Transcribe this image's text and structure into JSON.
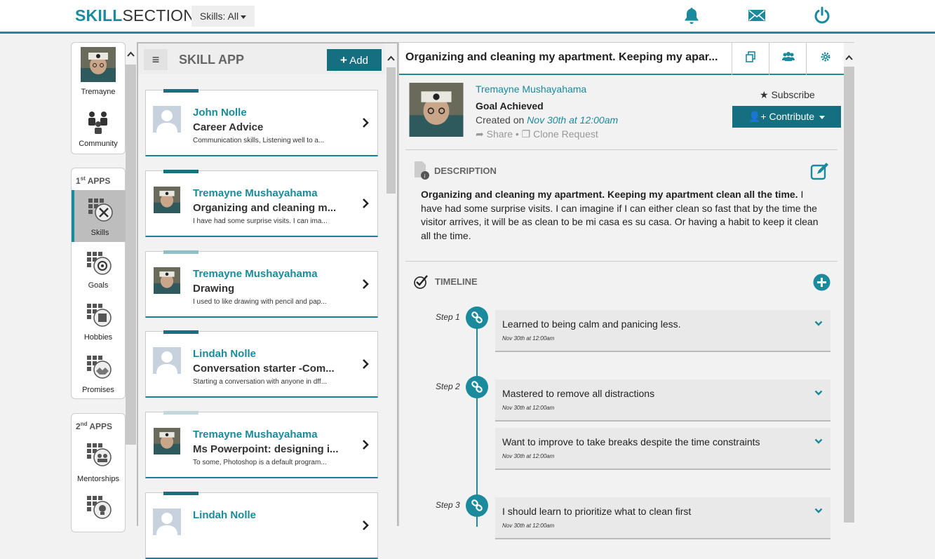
{
  "header": {
    "logo_a": "SKILL",
    "logo_b": "SECTION",
    "filter_label": "Skills: All",
    "icons": [
      "bell-icon",
      "envelope-icon",
      "power-icon"
    ]
  },
  "rail": {
    "profile_name": "Tremayne",
    "community_label": "Community",
    "first_apps_num": "1",
    "first_apps_sup": "st",
    "first_apps_word": "APPS",
    "second_apps_num": "2",
    "second_apps_sup": "nd",
    "second_apps_word": "APPS",
    "apps1": [
      "Skills",
      "Goals",
      "Hobbies",
      "Promises"
    ],
    "apps2": [
      "Mentorships"
    ]
  },
  "list": {
    "title": "SKILL APP",
    "add_label": "Add",
    "cards": [
      {
        "name": "John Nolle",
        "title": "Career Advice",
        "desc": "Communication skills, Listening well to a...",
        "avatar": "placeholder"
      },
      {
        "name": "Tremayne Mushayahama",
        "title": "Organizing and cleaning m...",
        "desc": "I have had some surprise visits. I can ima...",
        "avatar": "photo"
      },
      {
        "name": "Tremayne Mushayahama",
        "title": "Drawing",
        "desc": "I used to like drawing with pencil and pap...",
        "avatar": "photo"
      },
      {
        "name": "Lindah Nolle",
        "title": "Conversation starter -Com...",
        "desc": "Starting a conversation with anyone in dff...",
        "avatar": "placeholder"
      },
      {
        "name": "Tremayne Mushayahama",
        "title": "Ms Powerpoint: designing i...",
        "desc": "To some, Photoshop is a default program...",
        "avatar": "photo"
      },
      {
        "name": "Lindah Nolle",
        "title": "",
        "desc": "",
        "avatar": "placeholder"
      }
    ]
  },
  "detail": {
    "title": "Organizing and cleaning my apartment. Keeping my apar...",
    "author": "Tremayne Mushayahama",
    "status": "Goal Achieved",
    "created_prefix": "Created on",
    "created_date": "Nov 30th at 12:00am",
    "share_label": "Share",
    "clone_label": "Clone Request",
    "subscribe_label": "Subscribe",
    "contribute_label": "Contribute",
    "description_heading": "DESCRIPTION",
    "description_bold": "Organizing and cleaning my apartment. Keeping my apartment clean all the time.",
    "description_body": " I have had some surprise visits. I can imagine if I can either clean so fast that by the time the visitor arrives, it will be as clean to be mi casa es su casa. Or having a habit to keep it clean all the time.",
    "timeline_heading": "TIMELINE",
    "steps": [
      {
        "label": "Step 1",
        "items": [
          {
            "text": "Learned to being calm and panicing less.",
            "date": "Nov 30th at 12:00am"
          }
        ]
      },
      {
        "label": "Step 2",
        "items": [
          {
            "text": "Mastered to remove all distractions",
            "date": "Nov 30th at 12:00am"
          },
          {
            "text": "Want to improve to take breaks despite the time constraints",
            "date": "Nov 30th at 12:00am"
          }
        ]
      },
      {
        "label": "Step 3",
        "items": [
          {
            "text": "I should learn to prioritize what to clean first",
            "date": "Nov 30th at 12:00am"
          }
        ]
      }
    ]
  },
  "colors": {
    "accent": "#1a8a9c",
    "accent_dark": "#166f80"
  }
}
